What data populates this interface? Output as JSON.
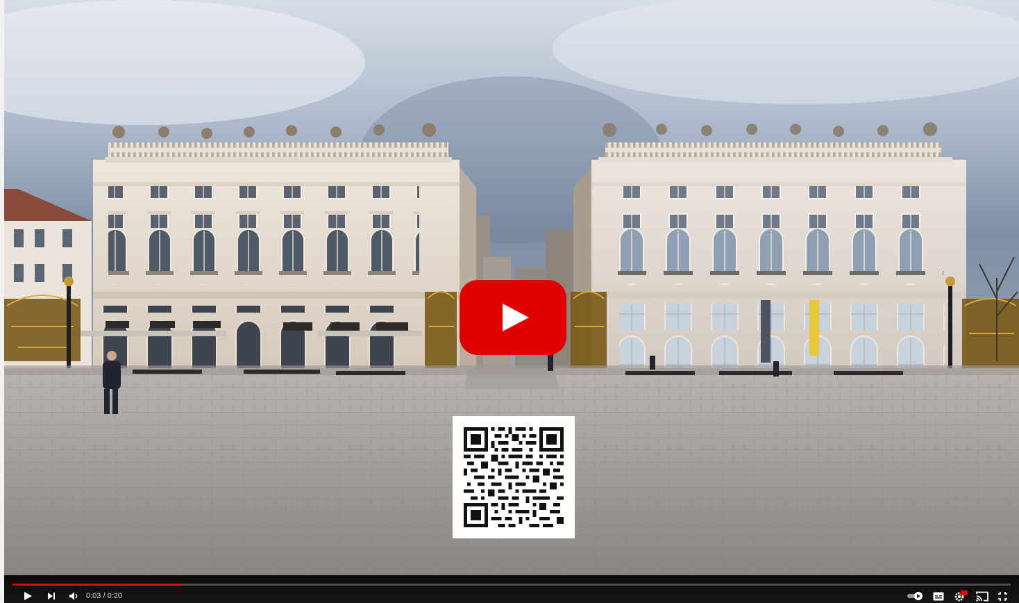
{
  "player": {
    "current_time": "0:03",
    "separator": " / ",
    "duration": "0:20",
    "progress": 0.17,
    "accent_color": "#ff0000",
    "progress_color": "#e00000"
  },
  "icons": {
    "big_play": "youtube-play-icon",
    "play": "play-icon",
    "next": "next-icon",
    "volume": "volume-icon",
    "autoplay": "autoplay-toggle-icon",
    "subtitles": "subtitles-icon",
    "settings": "settings-gear-icon",
    "settings_badge": "HD",
    "cast": "cast-icon",
    "fullscreen": "exit-fullscreen-icon"
  },
  "overlay": {
    "qr_code": "qr-code"
  }
}
